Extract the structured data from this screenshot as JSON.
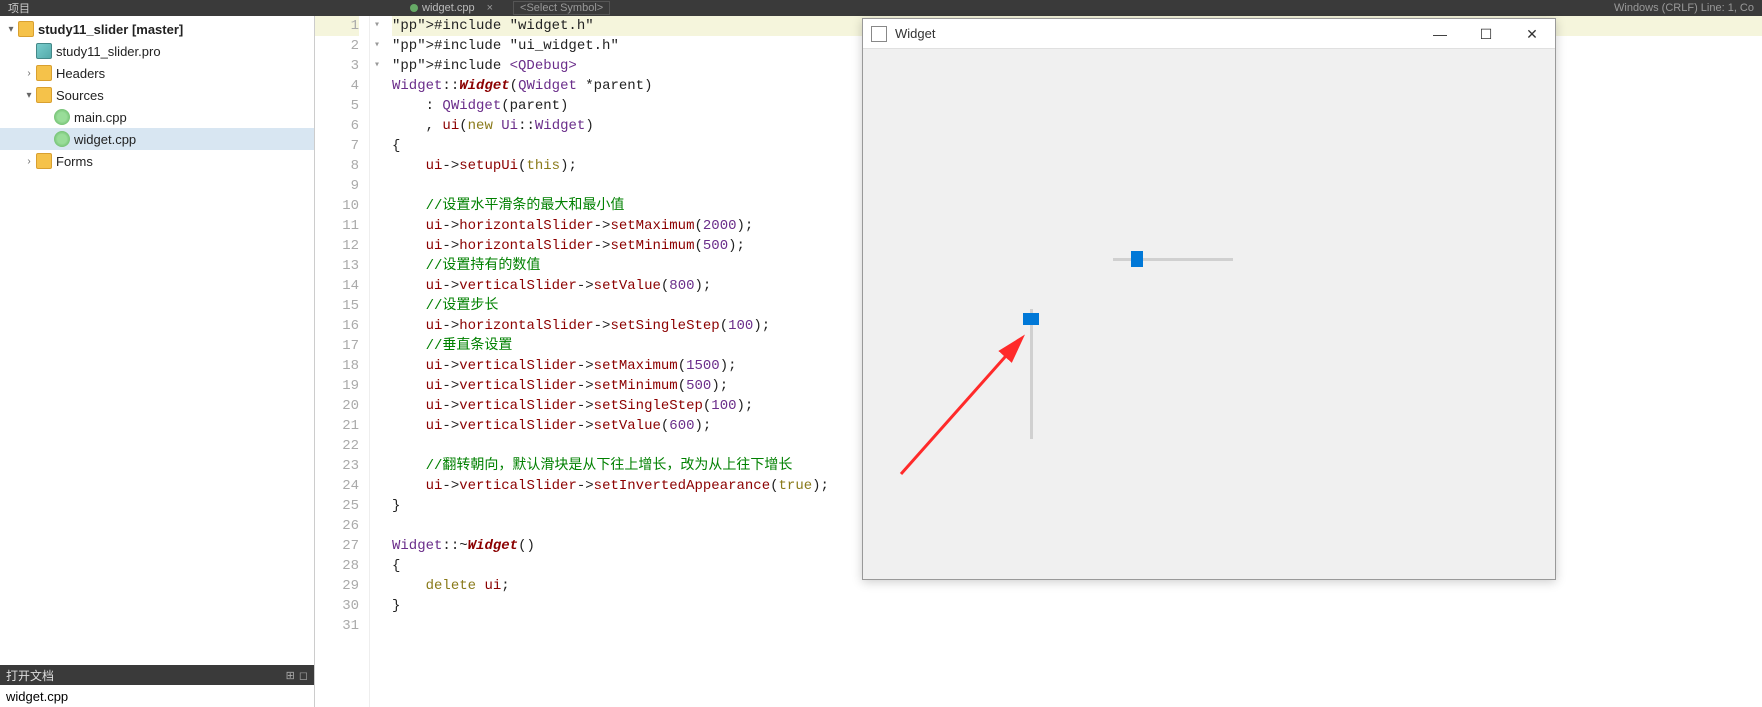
{
  "topbar": {
    "left_label": "项目",
    "tab_file": "widget.cpp",
    "tab_close": "×",
    "combo": "<Select Symbol>",
    "right_status": "Windows (CRLF)    Line: 1, Co"
  },
  "tree": {
    "root": "study11_slider [master]",
    "pro": "study11_slider.pro",
    "headers": "Headers",
    "sources": "Sources",
    "main_cpp": "main.cpp",
    "widget_cpp": "widget.cpp",
    "forms": "Forms"
  },
  "open_docs": {
    "header": "打开文档",
    "item": "widget.cpp"
  },
  "code_lines": [
    "#include \"widget.h\"",
    "#include \"ui_widget.h\"",
    "#include <QDebug>",
    "Widget::Widget(QWidget *parent)",
    "    : QWidget(parent)",
    "    , ui(new Ui::Widget)",
    "{",
    "    ui->setupUi(this);",
    "",
    "    //设置水平滑条的最大和最小值",
    "    ui->horizontalSlider->setMaximum(2000);",
    "    ui->horizontalSlider->setMinimum(500);",
    "    //设置持有的数值",
    "    ui->verticalSlider->setValue(800);",
    "    //设置步长",
    "    ui->horizontalSlider->setSingleStep(100);",
    "    //垂直条设置",
    "    ui->verticalSlider->setMaximum(1500);",
    "    ui->verticalSlider->setMinimum(500);",
    "    ui->verticalSlider->setSingleStep(100);",
    "    ui->verticalSlider->setValue(600);",
    "",
    "    //翻转朝向，默认滑块是从下往上增长，改为从上往下增长",
    "    ui->verticalSlider->setInvertedAppearance(true);",
    "}",
    "",
    "Widget::~Widget()",
    "{",
    "    delete ui;",
    "}",
    ""
  ],
  "widget_window": {
    "title": "Widget"
  }
}
